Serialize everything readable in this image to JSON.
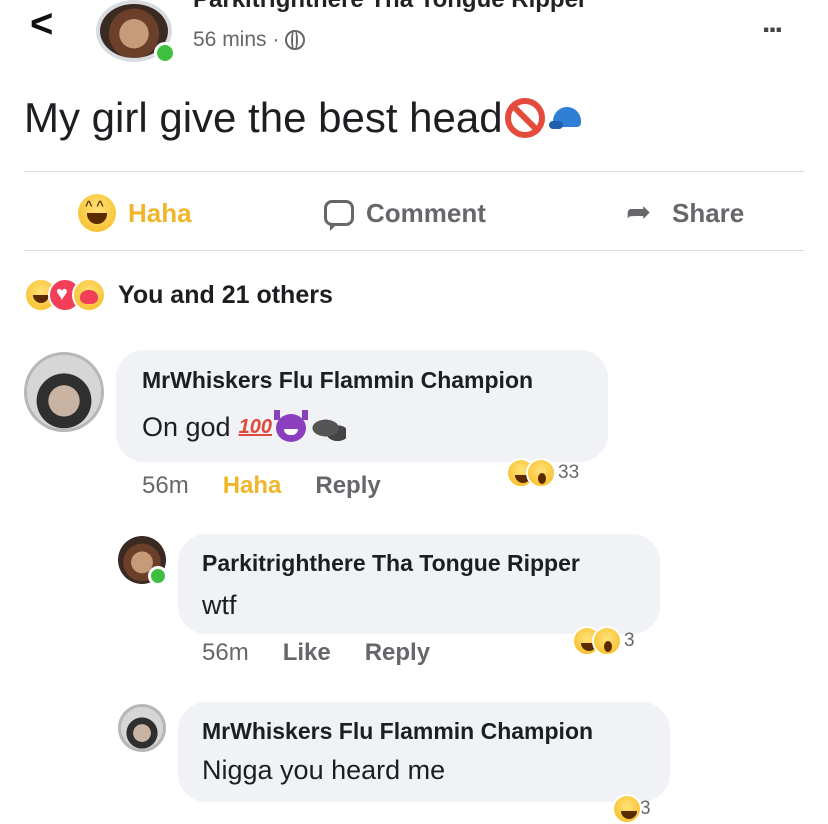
{
  "header": {
    "back_label": "<",
    "author": "Parkitrighthere Tha Tongue Ripper",
    "time": "56 mins ·",
    "more_label": "..."
  },
  "post": {
    "text": "My girl give the best head"
  },
  "actions": {
    "haha_label": "Haha",
    "comment_label": "Comment",
    "share_label": "Share"
  },
  "reaction_summary": {
    "text": "You and 21 others"
  },
  "comments": [
    {
      "author": "MrWhiskers Flu Flammin Champion",
      "text": "On god",
      "badge": "100",
      "time": "56m",
      "reaction_action": "Haha",
      "reply_label": "Reply",
      "reaction_count": "33"
    },
    {
      "author": "Parkitrighthere Tha Tongue Ripper",
      "text": "wtf",
      "time": "56m",
      "like_label": "Like",
      "reply_label": "Reply",
      "reaction_count": "3"
    },
    {
      "author": "MrWhiskers Flu Flammin Champion",
      "text": "Nigga you heard me",
      "reaction_count": "3"
    }
  ],
  "colors": {
    "haha_orange": "#f0b629",
    "bubble_bg": "#f0f2f5",
    "meta_gray": "#65676b",
    "online_green": "#3fbf3f",
    "no_sign_red": "#e44b3c",
    "cap_blue": "#2f7fd6"
  },
  "icons": [
    "back-arrow-icon",
    "globe-icon",
    "more-icon",
    "no-sign-icon",
    "cap-icon",
    "haha-icon",
    "comment-icon",
    "share-icon",
    "love-icon",
    "care-icon",
    "wow-icon",
    "devil-icon",
    "gorilla-icon",
    "hundred-icon"
  ]
}
